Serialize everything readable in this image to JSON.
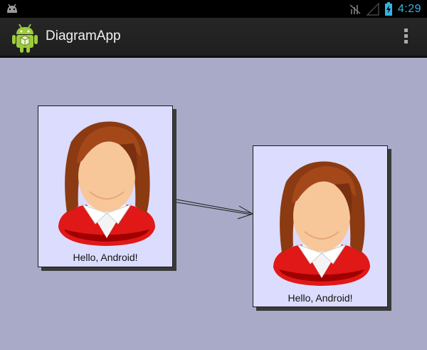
{
  "status_bar": {
    "time": "4:29",
    "icons": [
      "android-debug-icon",
      "no-signal-icon",
      "signal-icon",
      "battery-charging-icon"
    ]
  },
  "action_bar": {
    "app_title": "DiagramApp",
    "app_icon": "android-robot-icon",
    "overflow_icon": "overflow-menu-icon"
  },
  "diagram": {
    "nodes": [
      {
        "label": "Hello, Android!",
        "icon": "female-user-avatar-icon"
      },
      {
        "label": "Hello, Android!",
        "icon": "female-user-avatar-icon"
      }
    ],
    "connector": {
      "from": 0,
      "to": 1,
      "icon": "arrow-head-icon"
    }
  },
  "colors": {
    "canvas_bg": "#a8aac8",
    "node_bg": "#dcdcfe",
    "accent": "#33b5e5"
  }
}
